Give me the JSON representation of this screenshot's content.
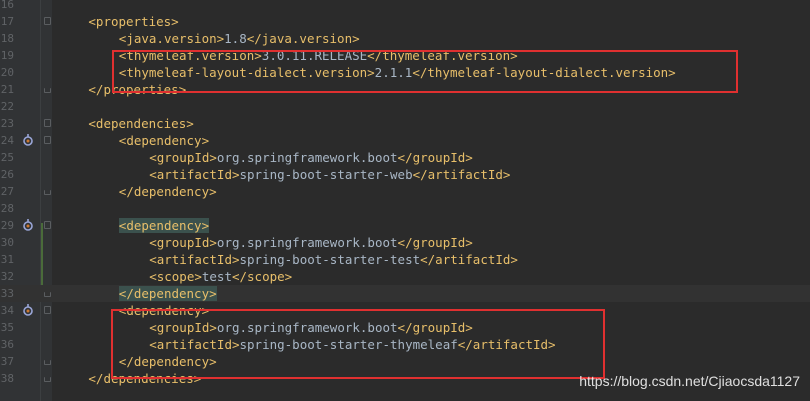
{
  "editor": {
    "lines": [
      {
        "num": "16",
        "indent": 0,
        "tag": "",
        "text": "",
        "fold": ""
      },
      {
        "num": "17",
        "indent": 4,
        "open": "<properties>",
        "fold": "start"
      },
      {
        "num": "18",
        "indent": 8,
        "open": "<java.version>",
        "value": "1.8",
        "close": "</java.version>"
      },
      {
        "num": "19",
        "indent": 8,
        "open": "<thymeleaf.version>",
        "value": "3.0.11.RELEASE",
        "close": "</thymeleaf.version>"
      },
      {
        "num": "20",
        "indent": 8,
        "open": "<thymeleaf-layout-dialect.version>",
        "value": "2.1.1",
        "close": "</thymeleaf-layout-dialect.version>"
      },
      {
        "num": "21",
        "indent": 4,
        "open": "</properties>",
        "fold": "end"
      },
      {
        "num": "22",
        "indent": 0
      },
      {
        "num": "23",
        "indent": 4,
        "open": "<dependencies>",
        "fold": "start"
      },
      {
        "num": "24",
        "indent": 8,
        "open": "<dependency>",
        "fold": "start",
        "icon": true
      },
      {
        "num": "25",
        "indent": 12,
        "open": "<groupId>",
        "value": "org.springframework.boot",
        "close": "</groupId>"
      },
      {
        "num": "26",
        "indent": 12,
        "open": "<artifactId>",
        "value": "spring-boot-starter-web",
        "close": "</artifactId>"
      },
      {
        "num": "27",
        "indent": 8,
        "open": "</dependency>",
        "fold": "end"
      },
      {
        "num": "28",
        "indent": 0
      },
      {
        "num": "29",
        "indent": 8,
        "open": "<dependency>",
        "fold": "start",
        "icon": true,
        "highlight": true
      },
      {
        "num": "30",
        "indent": 12,
        "open": "<groupId>",
        "value": "org.springframework.boot",
        "close": "</groupId>"
      },
      {
        "num": "31",
        "indent": 12,
        "open": "<artifactId>",
        "value": "spring-boot-starter-test",
        "close": "</artifactId>"
      },
      {
        "num": "32",
        "indent": 12,
        "open": "<scope>",
        "value": "test",
        "close": "</scope>"
      },
      {
        "num": "33",
        "indent": 8,
        "open": "</dependency>",
        "fold": "end",
        "highlight": true,
        "current": true
      },
      {
        "num": "34",
        "indent": 8,
        "open": "<dependency>",
        "fold": "start",
        "icon": true
      },
      {
        "num": "35",
        "indent": 12,
        "open": "<groupId>",
        "value": "org.springframework.boot",
        "close": "</groupId>"
      },
      {
        "num": "36",
        "indent": 12,
        "open": "<artifactId>",
        "value": "spring-boot-starter-thymeleaf",
        "close": "</artifactId>"
      },
      {
        "num": "37",
        "indent": 8,
        "open": "</dependency>",
        "fold": "end"
      },
      {
        "num": "38",
        "indent": 4,
        "open": "</dependencies>",
        "fold": "end"
      }
    ]
  },
  "watermark": "https://blog.csdn.net/Cjiaocsda1127",
  "colors": {
    "background": "#2b2b2b",
    "tag": "#e8bf6a",
    "text": "#a9b7c6",
    "annotation_box": "#e03030"
  },
  "icons": {
    "gutter_marker": "maven-dependency-icon"
  }
}
